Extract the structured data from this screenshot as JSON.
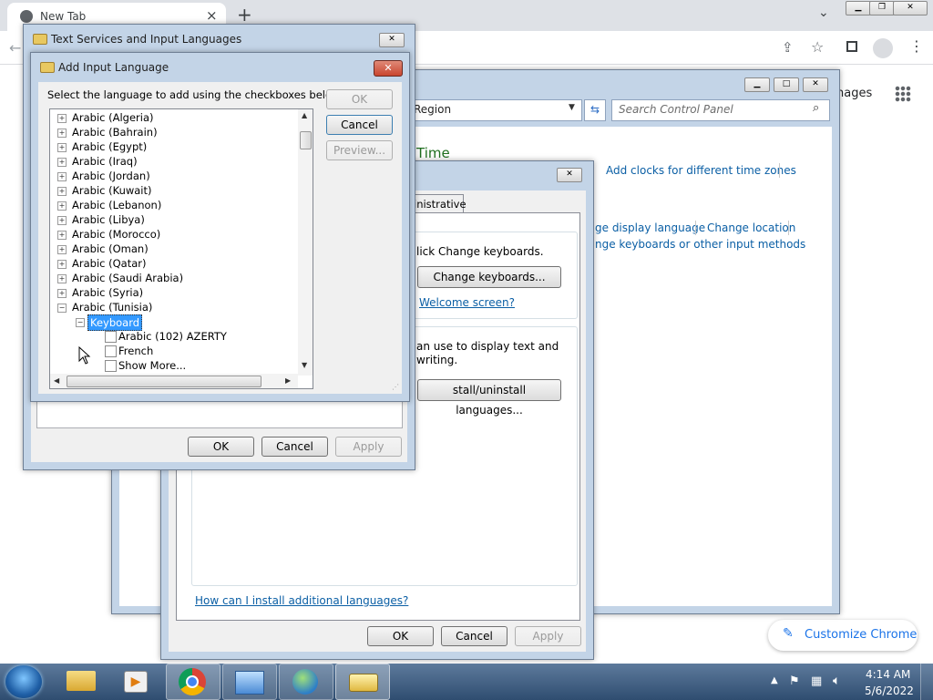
{
  "chrome": {
    "tab_title": "New Tab",
    "apps_partial": "nages",
    "customize_label": "Customize Chrome"
  },
  "control_panel": {
    "breadcrumb_partial": "Region",
    "search_placeholder": "Search Control Panel",
    "heading_partial": "Time",
    "links": {
      "add_clocks": "Add clocks for different time zones",
      "change_display_language_partial": "ge display language",
      "change_location": "Change location",
      "change_keyboards_partial": "nge keyboards or other input methods"
    }
  },
  "region_dialog": {
    "tab_partial": "inistrative",
    "click_change_partial": "lick Change keyboards.",
    "change_keyboards_button": "Change keyboards...",
    "welcome_link_partial": "Welcome screen?",
    "display_text_partial_1": "an use to display text and",
    "display_text_partial_2": "writing.",
    "install_button_partial": "stall/uninstall languages...",
    "install_help_link": "How can I install additional languages?",
    "ok": "OK",
    "cancel": "Cancel",
    "apply": "Apply"
  },
  "text_services_dialog": {
    "title": "Text Services and Input Languages",
    "ok": "OK",
    "cancel": "Cancel",
    "apply": "Apply"
  },
  "add_input_dialog": {
    "title": "Add Input Language",
    "instruction": "Select the language to add using the checkboxes below.",
    "ok": "OK",
    "cancel": "Cancel",
    "preview": "Preview...",
    "languages": [
      "Arabic (Algeria)",
      "Arabic (Bahrain)",
      "Arabic (Egypt)",
      "Arabic (Iraq)",
      "Arabic (Jordan)",
      "Arabic (Kuwait)",
      "Arabic (Lebanon)",
      "Arabic (Libya)",
      "Arabic (Morocco)",
      "Arabic (Oman)",
      "Arabic (Qatar)",
      "Arabic (Saudi Arabia)",
      "Arabic (Syria)",
      "Arabic (Tunisia)"
    ],
    "keyboard_node": "Keyboard",
    "keyboard_options": [
      "Arabic (102) AZERTY",
      "French",
      "Show More..."
    ]
  },
  "taskbar": {
    "time": "4:14 AM",
    "date": "5/6/2022"
  },
  "colors": {
    "accent_link": "#0b5fa5",
    "selection": "#3399ff",
    "titlebar": "#c3d4e7",
    "close_red": "#c9452f"
  }
}
